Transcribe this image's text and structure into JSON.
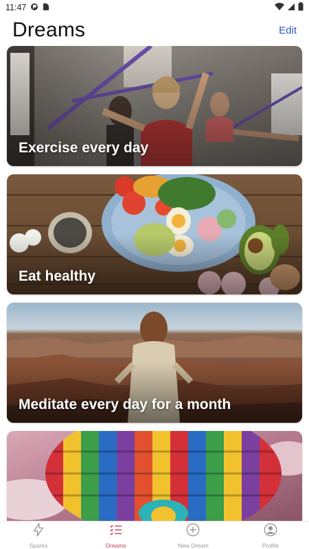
{
  "status_bar": {
    "time": "11:47",
    "icons": [
      "notification-icon",
      "sim-card-icon",
      "wifi-icon",
      "signal-icon",
      "battery-icon"
    ]
  },
  "header": {
    "title": "Dreams",
    "edit_label": "Edit"
  },
  "cards": [
    {
      "caption": "Exercise every day",
      "image": "exercise-photo"
    },
    {
      "caption": "Eat healthy",
      "image": "food-plate-photo"
    },
    {
      "caption": "Meditate every day for a month",
      "image": "canyon-meditation-photo"
    },
    {
      "caption": "",
      "image": "hot-air-balloon-photo"
    }
  ],
  "bottom_nav": {
    "items": [
      {
        "label": "Sparks",
        "icon": "lightning-icon",
        "active": false
      },
      {
        "label": "Dreams",
        "icon": "list-icon",
        "active": true
      },
      {
        "label": "New Dream",
        "icon": "plus-circle-icon",
        "active": false
      },
      {
        "label": "Profile",
        "icon": "profile-icon",
        "active": false
      }
    ]
  },
  "colors": {
    "accent": "#2a57c9",
    "active_tab": "#cc3e55",
    "inactive_tab": "#9a9a9a"
  }
}
